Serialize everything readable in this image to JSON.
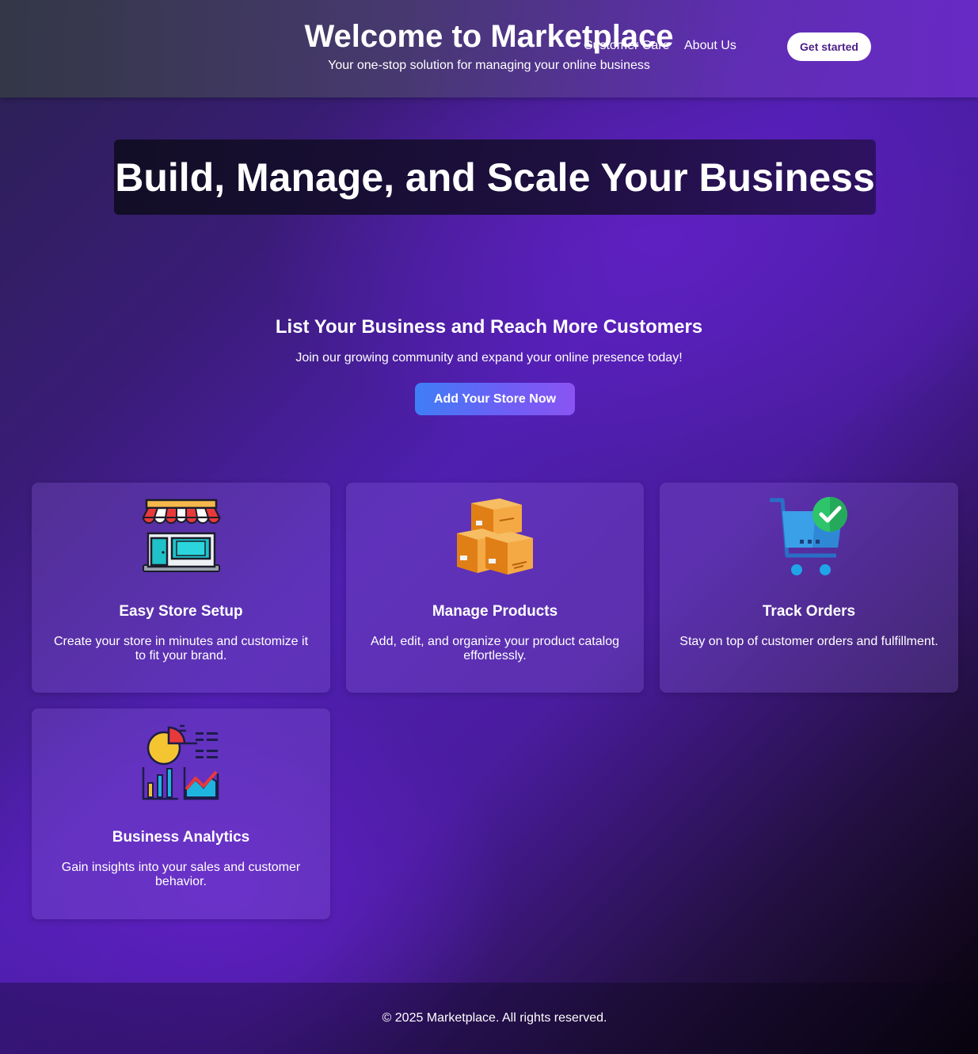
{
  "header": {
    "title": "Welcome to Marketplace",
    "subtitle": "Your one-stop solution for managing your online business",
    "nav": {
      "customer_care": "Customer Care",
      "about": "About Us"
    },
    "cta": "Get started"
  },
  "hero": {
    "title": "Build, Manage, and Scale Your Business"
  },
  "listing": {
    "title": "List Your Business and Reach More Customers",
    "subtitle": "Join our growing community and expand your online presence today!",
    "button": "Add Your Store Now"
  },
  "features": [
    {
      "icon": "storefront-icon",
      "title": "Easy Store Setup",
      "description": "Create your store in minutes and customize it to fit your brand."
    },
    {
      "icon": "boxes-icon",
      "title": "Manage Products",
      "description": "Add, edit, and organize your product catalog effortlessly."
    },
    {
      "icon": "cart-check-icon",
      "title": "Track Orders",
      "description": "Stay on top of customer orders and fulfillment."
    },
    {
      "icon": "analytics-icon",
      "title": "Business Analytics",
      "description": "Gain insights into your sales and customer behavior."
    }
  ],
  "footer": {
    "copyright": "© 2025 Marketplace. All rights reserved."
  },
  "colors": {
    "accent_gradient_start": "#3f7ef7",
    "accent_gradient_end": "#8a54f2",
    "cta_text": "#4b1d86",
    "background_purple": "#4f1fb0"
  }
}
